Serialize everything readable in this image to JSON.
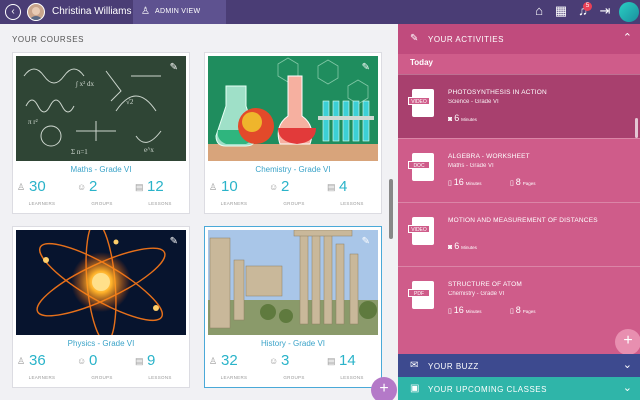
{
  "topbar": {
    "user_name": "Christina Williams",
    "admin_label": "ADMIN VIEW",
    "notification_count": "5",
    "icons": [
      "back-icon",
      "home-icon",
      "calendar-icon",
      "bell-icon",
      "dashboard-icon",
      "logout-icon"
    ]
  },
  "courses": {
    "heading": "YOUR COURSES",
    "items": [
      {
        "title": "Maths - Grade VI",
        "learners": "30",
        "groups": "2",
        "lessons": "12"
      },
      {
        "title": "Chemistry - Grade VI",
        "learners": "10",
        "groups": "2",
        "lessons": "4"
      },
      {
        "title": "Physics - Grade VI",
        "learners": "36",
        "groups": "0",
        "lessons": "9"
      },
      {
        "title": "History - Grade VI",
        "learners": "32",
        "groups": "3",
        "lessons": "14"
      }
    ],
    "labels": {
      "learners": "LEARNERS",
      "groups": "GROUPS",
      "lessons": "LESSONS"
    }
  },
  "activities": {
    "heading": "YOUR ACTIVITIES",
    "day": "Today",
    "items": [
      {
        "type": "VIDEO",
        "name": "PHOTOSYNTHESIS IN ACTION",
        "sub": "Science - Grade VI",
        "m1_num": "6",
        "m1_unit": "Minutes",
        "m2_num": "",
        "m2_unit": ""
      },
      {
        "type": "DOC",
        "name": "ALGEBRA - WORKSHEET",
        "sub": "Maths - Grade VI",
        "m1_num": "16",
        "m1_unit": "Minutes",
        "m2_num": "8",
        "m2_unit": "Pages"
      },
      {
        "type": "VIDEO",
        "name": "MOTION AND MEASUREMENT OF DISTANCES",
        "sub": "",
        "m1_num": "6",
        "m1_unit": "Minutes",
        "m2_num": "",
        "m2_unit": ""
      },
      {
        "type": "PDF",
        "name": "STRUCTURE OF ATOM",
        "sub": "Chemistry - Grade VI",
        "m1_num": "16",
        "m1_unit": "Minutes",
        "m2_num": "8",
        "m2_unit": "Pages"
      }
    ]
  },
  "buzz": {
    "heading": "YOUR BUZZ"
  },
  "upcoming": {
    "heading": "YOUR UPCOMING CLASSES"
  },
  "colors": {
    "topbar": "#4a3d75",
    "activities": "#cf5c8a",
    "buzz": "#3d4a8f",
    "upcoming": "#2fb5a9",
    "accent": "#2ab3c9"
  }
}
